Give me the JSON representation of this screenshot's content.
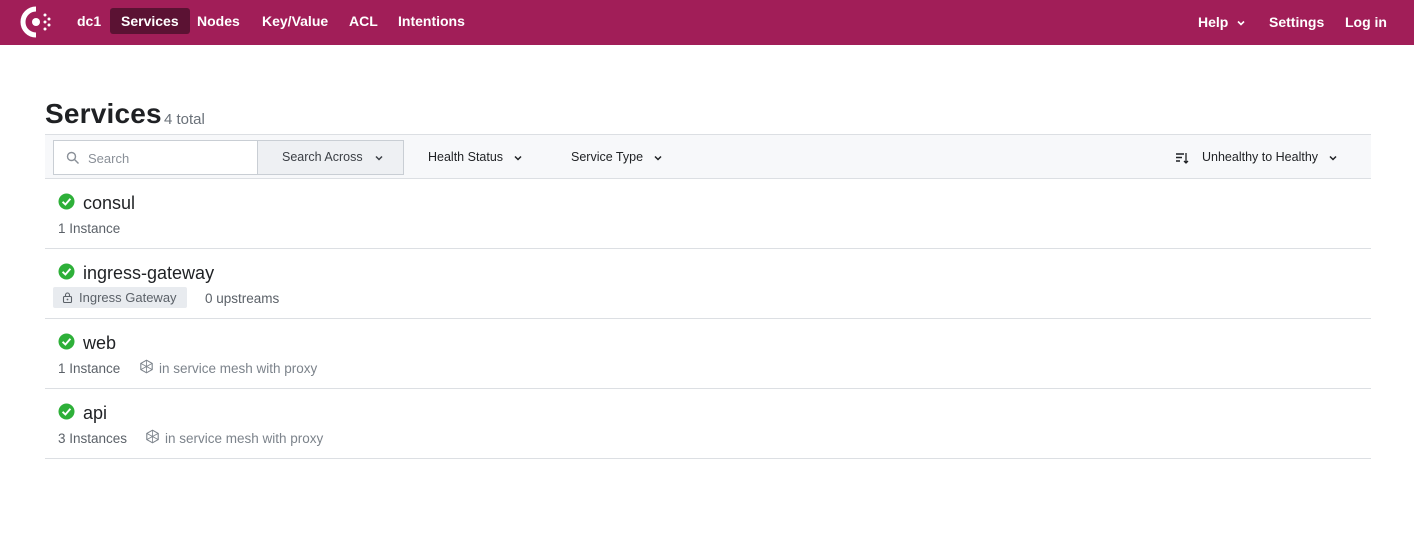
{
  "nav": {
    "datacenter": "dc1",
    "items": [
      {
        "label": "Services",
        "active": true
      },
      {
        "label": "Nodes",
        "active": false
      },
      {
        "label": "Key/Value",
        "active": false
      },
      {
        "label": "ACL",
        "active": false
      },
      {
        "label": "Intentions",
        "active": false
      }
    ],
    "right": {
      "help": "Help",
      "settings": "Settings",
      "login": "Log in"
    },
    "colors": {
      "bar": "#a11e58",
      "active": "#5b1233"
    }
  },
  "header": {
    "title": "Services",
    "count": "4 total"
  },
  "filters": {
    "search_placeholder": "Search",
    "search_across": "Search Across",
    "health_status": "Health Status",
    "service_type": "Service Type",
    "sort": "Unhealthy to Healthy"
  },
  "services": [
    {
      "name": "consul",
      "status": "passing",
      "instances": "1 Instance"
    },
    {
      "name": "ingress-gateway",
      "status": "passing",
      "badge": "Ingress Gateway",
      "upstreams": "0 upstreams"
    },
    {
      "name": "web",
      "status": "passing",
      "instances": "1 Instance",
      "mesh": "in service mesh with proxy"
    },
    {
      "name": "api",
      "status": "passing",
      "instances": "3 Instances",
      "mesh": "in service mesh with proxy"
    }
  ],
  "icons": {
    "logo": "consul-logo-icon",
    "search": "search-icon",
    "chevron": "chevron-down-icon",
    "sort": "sort-icon",
    "status": "check-circle-icon",
    "gateway": "gateway-icon",
    "mesh": "service-mesh-icon"
  },
  "status_color": "#2eb039"
}
